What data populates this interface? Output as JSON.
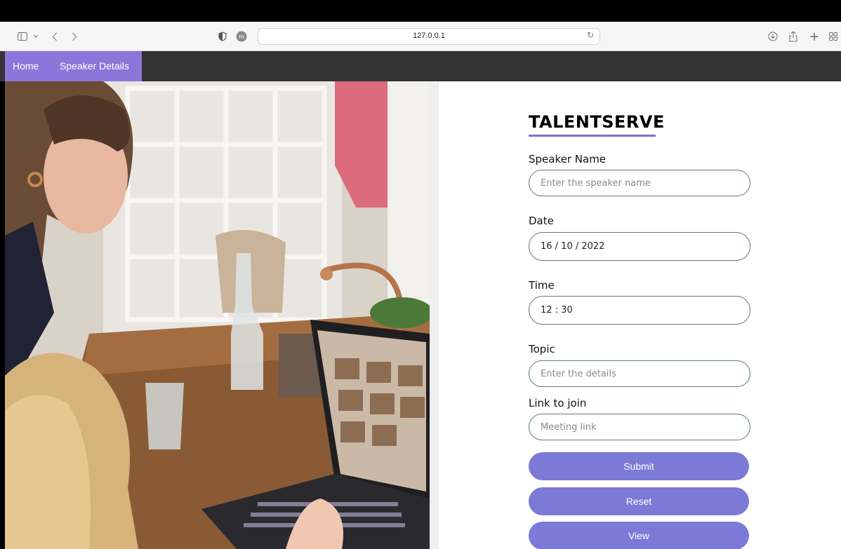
{
  "browser": {
    "url": "127.0.0.1",
    "icons": [
      "sidebar-icon",
      "chevron-down-icon",
      "back-icon",
      "forward-icon",
      "shield-icon",
      "extension-icon",
      "reload-icon",
      "download-icon",
      "share-icon",
      "new-tab-icon",
      "tab-overview-icon"
    ]
  },
  "nav": {
    "home": "Home",
    "speaker_details": "Speaker Details",
    "active_color": "#8b76d9",
    "bg_color": "#333333"
  },
  "form": {
    "brand": "TALENTSERVE",
    "speaker_name": {
      "label": "Speaker Name",
      "placeholder": "Enter the speaker name",
      "value": ""
    },
    "date": {
      "label": "Date",
      "value": "16 / 10 / 2022"
    },
    "time": {
      "label": "Time",
      "value": "12 : 30"
    },
    "topic": {
      "label": "Topic",
      "placeholder": "Enter the details",
      "value": ""
    },
    "link": {
      "label": "Link to join",
      "placeholder": "Meeting link",
      "value": ""
    },
    "buttons": {
      "submit": "Submit",
      "reset": "Reset",
      "view": "View"
    },
    "accent_color": "#7b7ad7"
  }
}
